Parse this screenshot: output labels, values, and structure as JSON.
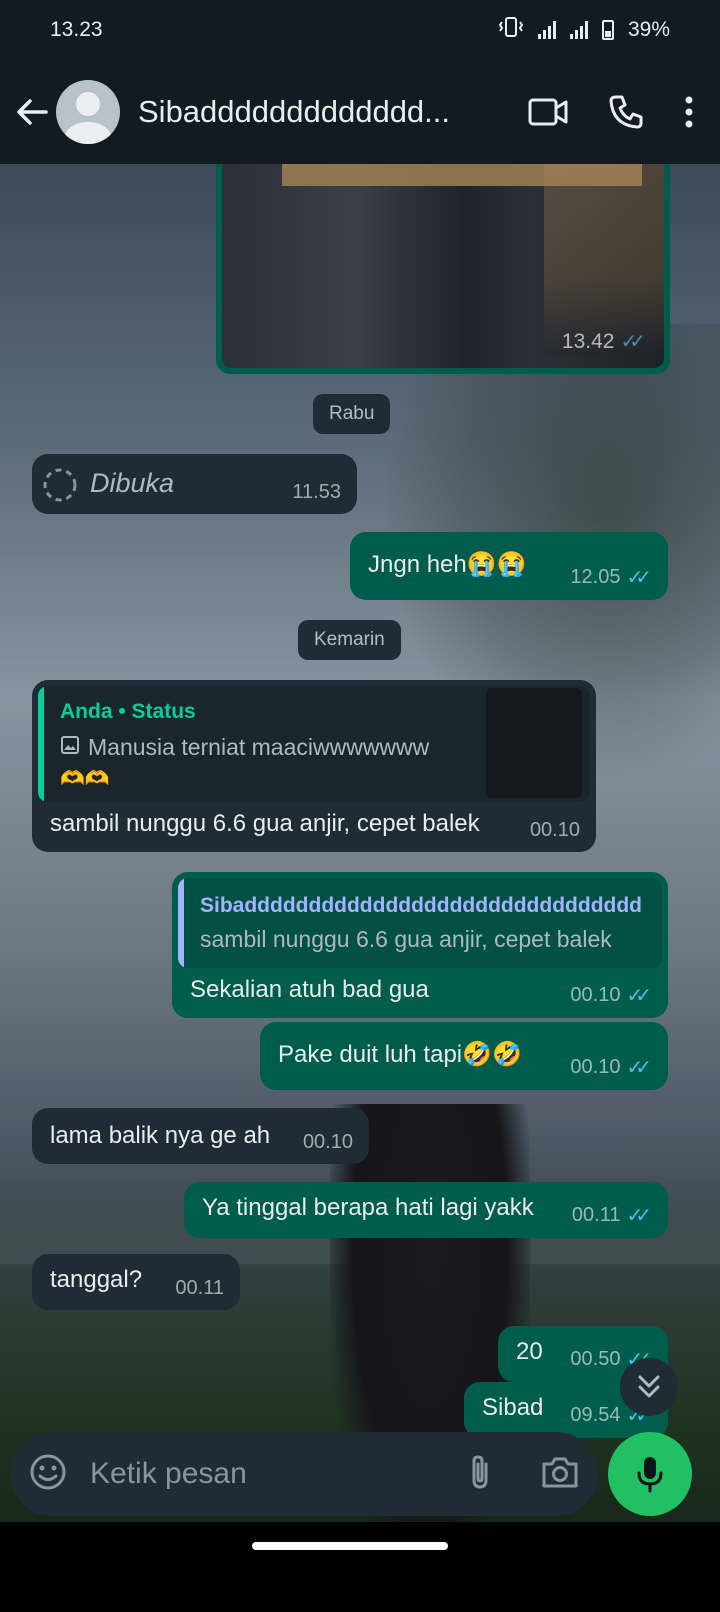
{
  "status_bar": {
    "time": "13.23",
    "battery": "39%"
  },
  "header": {
    "contact_name": "Sibaddddddddddddd..."
  },
  "messages": {
    "image_time": "13.42",
    "date_rabu": "Rabu",
    "opened_label": "Dibuka",
    "opened_time": "11.53",
    "m1_text": "Jngn heh😭😭",
    "m1_time": "12.05",
    "date_kemarin": "Kemarin",
    "status_reply_author": "Anda",
    "status_reply_type": "Status",
    "status_reply_text": "Manusia terniat maaciwwwwwww",
    "status_reply_emoji": "🫶🫶",
    "m2_text": "sambil nunggu 6.6 gua anjir, cepet balek",
    "m2_time": "00.10",
    "quote_author": "Sibaddddddddddddddddddddddddddddddd",
    "quote_text": "sambil nunggu 6.6 gua anjir, cepet balek",
    "m3_text": "Sekalian atuh bad gua",
    "m3_time": "00.10",
    "m4_text": "Pake duit luh tapi🤣🤣",
    "m4_time": "00.10",
    "m5_text": "lama balik nya ge ah",
    "m5_time": "00.10",
    "m6_text": "Ya tinggal berapa hati lagi yakk",
    "m6_time": "00.11",
    "m7_text": "tanggal?",
    "m7_time": "00.11",
    "m8_text": "20",
    "m8_time": "00.50",
    "m9_text": "Sibad",
    "m9_time": "09.54"
  },
  "composer": {
    "placeholder": "Ketik pesan"
  },
  "icons": {
    "back": "arrow-left-icon",
    "video": "video-call-icon",
    "call": "phone-icon",
    "menu": "more-vert-icon",
    "emoji": "emoji-icon",
    "attach": "paperclip-icon",
    "camera": "camera-icon",
    "mic": "microphone-icon",
    "scroll": "chevron-double-down-icon"
  },
  "colors": {
    "header_bg": "#111b21",
    "incoming": "#1f2c34",
    "outgoing": "#005c4b",
    "accent": "#21c063",
    "read_ticks": "#53bdeb"
  }
}
